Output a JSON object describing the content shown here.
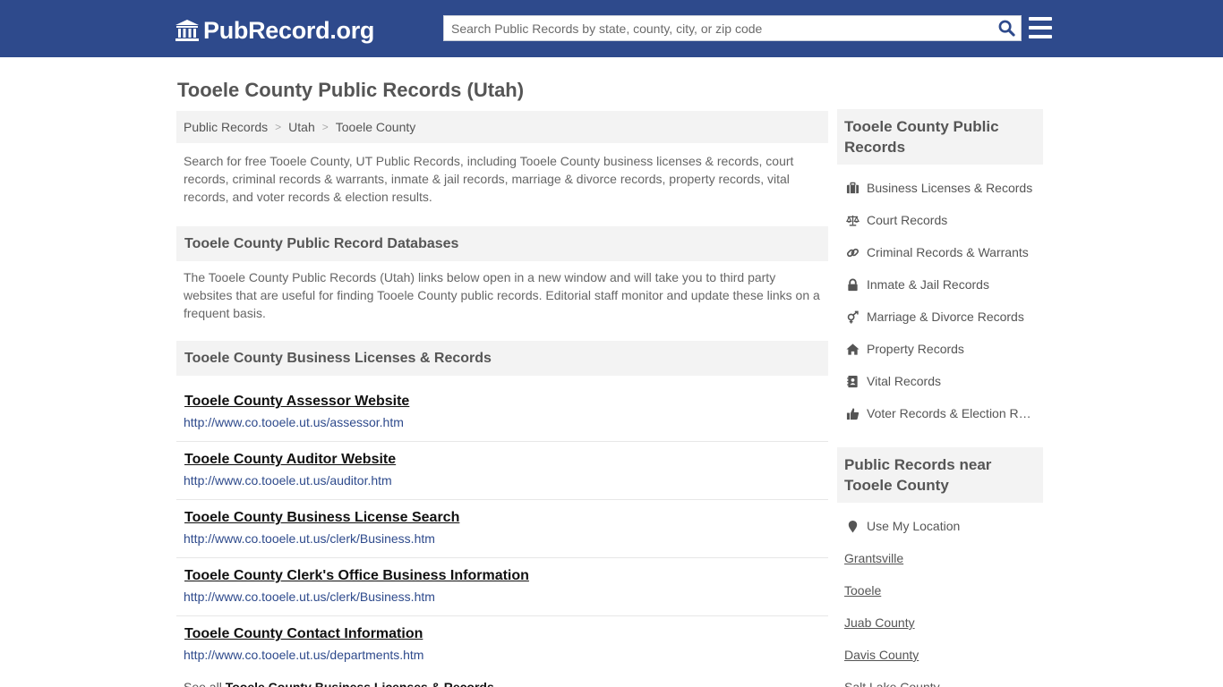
{
  "header": {
    "logo_text": "PubRecord.org",
    "search_placeholder": "Search Public Records by state, county, city, or zip code",
    "search_value": ""
  },
  "page_title": "Tooele County Public Records (Utah)",
  "breadcrumb": [
    "Public Records",
    "Utah",
    "Tooele County"
  ],
  "breadcrumb_sep": ">",
  "intro": "Search for free Tooele County, UT Public Records, including Tooele County business licenses & records, court records, criminal records & warrants, inmate & jail records, marriage & divorce records, property records, vital records, and voter records & election results.",
  "databases": {
    "heading": "Tooele County Public Record Databases",
    "text": "The Tooele County Public Records (Utah) links below open in a new window and will take you to third party websites that are useful for finding Tooele County public records. Editorial staff monitor and update these links on a frequent basis."
  },
  "business": {
    "heading": "Tooele County Business Licenses & Records",
    "links": [
      {
        "title": "Tooele County Assessor Website",
        "url": "http://www.co.tooele.ut.us/assessor.htm"
      },
      {
        "title": "Tooele County Auditor Website",
        "url": "http://www.co.tooele.ut.us/auditor.htm"
      },
      {
        "title": "Tooele County Business License Search",
        "url": "http://www.co.tooele.ut.us/clerk/Business.htm"
      },
      {
        "title": "Tooele County Clerk's Office Business Information",
        "url": "http://www.co.tooele.ut.us/clerk/Business.htm"
      },
      {
        "title": "Tooele County Contact Information",
        "url": "http://www.co.tooele.ut.us/departments.htm"
      }
    ],
    "see_all_prefix": "See all",
    "see_all_link": "Tooele County Business Licenses & Records"
  },
  "sidebar": {
    "heading": "Tooele County Public Records",
    "items": [
      {
        "label": "Business Licenses & Records",
        "icon": "briefcase-icon"
      },
      {
        "label": "Court Records",
        "icon": "scales-icon"
      },
      {
        "label": "Criminal Records & Warrants",
        "icon": "link-icon"
      },
      {
        "label": "Inmate & Jail Records",
        "icon": "lock-icon"
      },
      {
        "label": "Marriage & Divorce Records",
        "icon": "gender-icon"
      },
      {
        "label": "Property Records",
        "icon": "home-icon"
      },
      {
        "label": "Vital Records",
        "icon": "address-book-icon"
      },
      {
        "label": "Voter Records & Election Results",
        "icon": "thumbs-up-icon"
      }
    ],
    "near_heading": "Public Records near Tooele County",
    "near_location": "Use My Location",
    "near_items": [
      "Grantsville",
      "Tooele",
      "Juab County",
      "Davis County",
      "Salt Lake County"
    ]
  },
  "colors": {
    "header_bg": "#2e4a8c",
    "link_url": "#2e4a8c",
    "panel_bg": "#f3f3f3"
  }
}
